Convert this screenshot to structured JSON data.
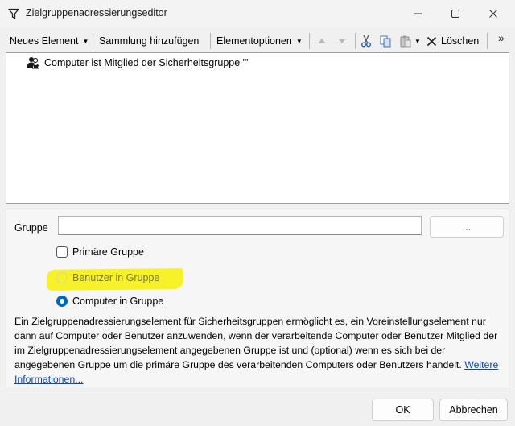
{
  "window": {
    "title": "Zielgruppenadressierungseditor"
  },
  "toolbar": {
    "new_item": "Neues Element",
    "add_collection": "Sammlung hinzufügen",
    "item_options": "Elementoptionen",
    "delete": "Löschen",
    "overflow": "»"
  },
  "tree": {
    "items": [
      {
        "label": "Computer ist Mitglied der Sicherheitsgruppe \"\""
      }
    ]
  },
  "details": {
    "group_label": "Gruppe",
    "group_value": "",
    "browse_label": "...",
    "primary_group_label": "Primäre Gruppe",
    "primary_group_checked": false,
    "user_in_group_label": "Benutzer in Gruppe",
    "computer_in_group_label": "Computer in Gruppe",
    "selected_option": "Computer in Gruppe",
    "description": "Ein Zielgruppenadressierungselement für Sicherheitsgruppen ermöglicht es, ein Voreinstellungselement nur dann auf Computer oder Benutzer anzuwenden, wenn der verarbeitende Computer oder Benutzer Mitglied der im Zielgruppenadressierungselement angegebenen Gruppe ist und (optional) wenn es sich bei der angegebenen Gruppe um die primäre Gruppe des verarbeitenden Computers oder Benutzers handelt.",
    "more_info_link": "Weitere Informationen..."
  },
  "buttons": {
    "ok": "OK",
    "cancel": "Abbrechen"
  },
  "colors": {
    "highlight": "#f5f01e",
    "accent": "#0067c0",
    "link": "#0645d8"
  }
}
